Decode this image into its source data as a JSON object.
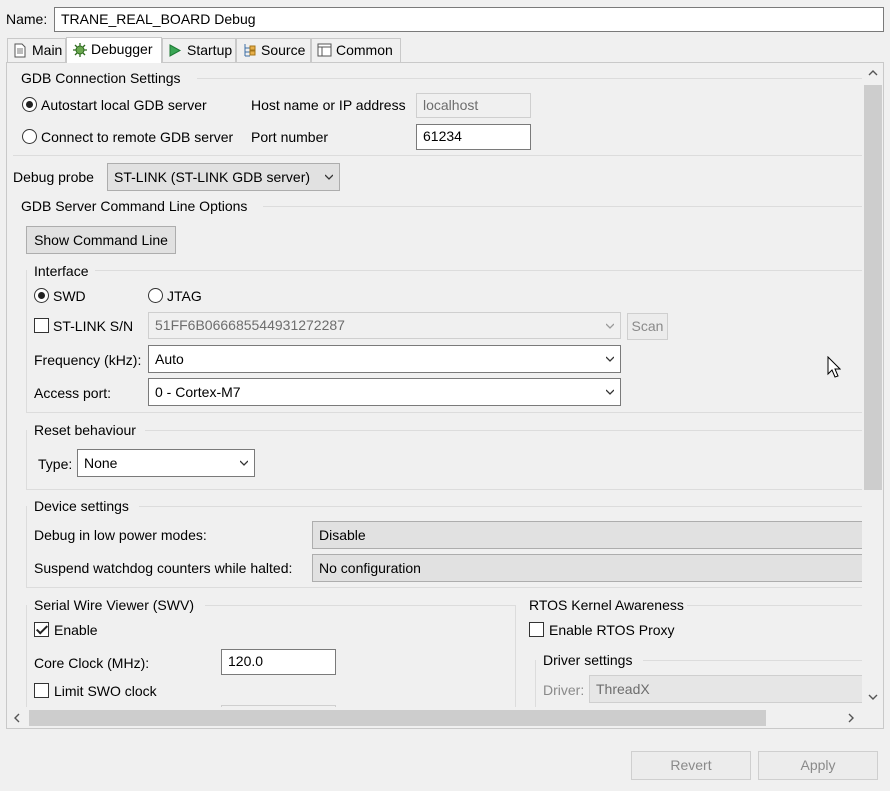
{
  "name": {
    "label": "Name:",
    "value": "TRANE_REAL_BOARD Debug"
  },
  "tabs": [
    {
      "label": "Main",
      "icon": "document-icon"
    },
    {
      "label": "Debugger",
      "icon": "bug-gear-icon",
      "active": true
    },
    {
      "label": "Startup",
      "icon": "play-icon"
    },
    {
      "label": "Source",
      "icon": "source-tree-icon"
    },
    {
      "label": "Common",
      "icon": "window-icon"
    }
  ],
  "gdb_connection": {
    "title": "GDB Connection Settings",
    "autostart_label": "Autostart local GDB server",
    "remote_label": "Connect to remote GDB server",
    "host_label": "Host name or IP address",
    "host_value": "localhost",
    "port_label": "Port number",
    "port_value": "61234"
  },
  "debug_probe": {
    "label": "Debug probe",
    "value": "ST-LINK (ST-LINK GDB server)"
  },
  "gdb_server_options": {
    "title": "GDB Server Command Line Options",
    "show_command_line": "Show Command Line"
  },
  "interface": {
    "title": "Interface",
    "swd_label": "SWD",
    "jtag_label": "JTAG",
    "stlink_sn_label": "ST-LINK S/N",
    "stlink_sn_value": "51FF6B066685544931272287",
    "scan_label": "Scan",
    "frequency_label": "Frequency (kHz):",
    "frequency_value": "Auto",
    "access_port_label": "Access port:",
    "access_port_value": "0 - Cortex-M7"
  },
  "reset": {
    "title": "Reset behaviour",
    "type_label": "Type:",
    "type_value": "None"
  },
  "device": {
    "title": "Device settings",
    "low_power_label": "Debug in low power modes:",
    "low_power_value": "Disable",
    "watchdog_label": "Suspend watchdog counters while halted:",
    "watchdog_value": "No configuration"
  },
  "swv": {
    "title": "Serial Wire Viewer (SWV)",
    "enable_label": "Enable",
    "core_clock_label": "Core Clock (MHz):",
    "core_clock_value": "120.0",
    "limit_swo_label": "Limit SWO clock"
  },
  "rtos": {
    "title": "RTOS Kernel Awareness",
    "enable_proxy_label": "Enable RTOS Proxy",
    "driver_settings_title": "Driver settings",
    "driver_label": "Driver:",
    "driver_value": "ThreadX"
  },
  "footer": {
    "revert": "Revert",
    "apply": "Apply"
  }
}
